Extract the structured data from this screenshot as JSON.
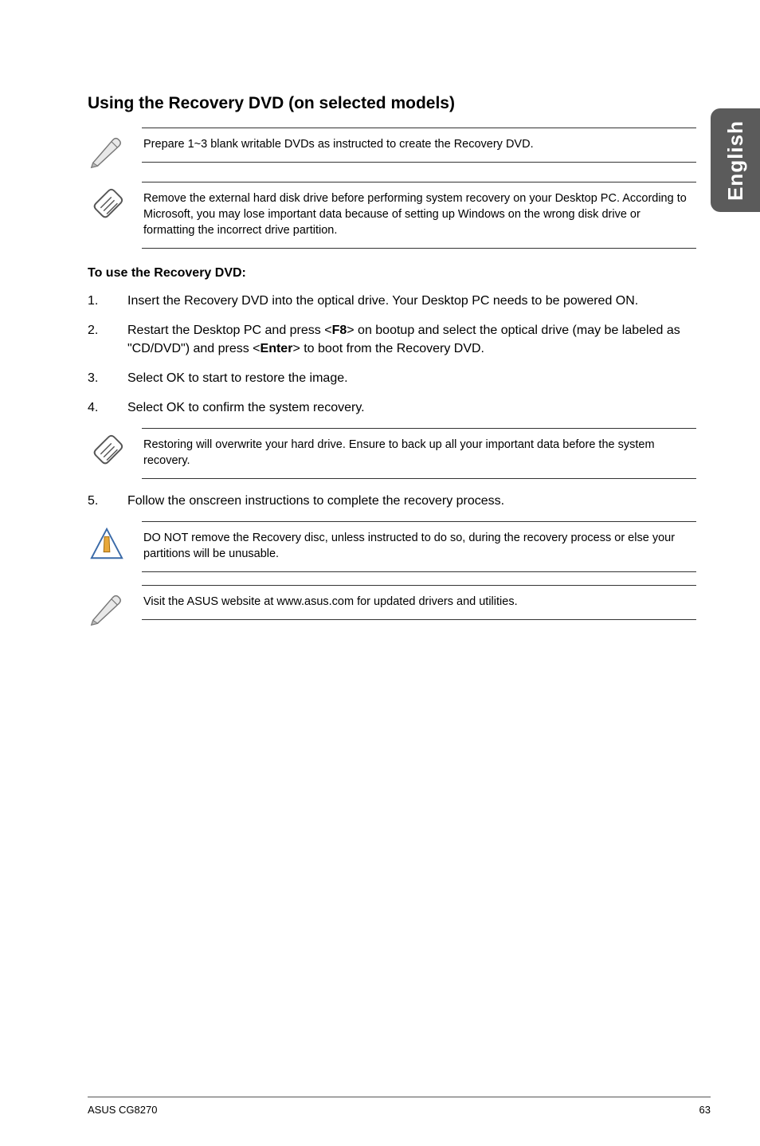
{
  "side_label": "English",
  "heading": "Using the Recovery DVD (on selected models)",
  "note_prepare": "Prepare 1~3 blank writable DVDs as instructed to create the Recovery DVD.",
  "note_remove": "Remove the external hard disk drive before performing system recovery on your Desktop PC. According to Microsoft, you may lose important data because of setting up Windows on the wrong disk drive or formatting the incorrect drive partition.",
  "section_title": "To use the Recovery DVD:",
  "steps": {
    "s1": "Insert the Recovery DVD into the optical drive. Your Desktop PC needs to be powered ON.",
    "s2_pre": "Restart the Desktop PC and press <",
    "s2_key1": "F8",
    "s2_mid": "> on bootup and select the optical drive (may be labeled as \"CD/DVD\") and press <",
    "s2_key2": "Enter",
    "s2_post": "> to boot from the Recovery DVD.",
    "s3": "Select OK to start to restore the image.",
    "s4": "Select OK to confirm the system recovery.",
    "s5": "Follow the onscreen instructions to complete the recovery process."
  },
  "note_restore": "Restoring will overwrite your hard drive. Ensure to back up all your important data before the system recovery.",
  "note_donot": "DO NOT remove the Recovery disc, unless instructed to do so, during the recovery process or else your partitions will be unusable.",
  "note_visit": "Visit the ASUS website at www.asus.com for updated drivers and utilities.",
  "footer_left": "ASUS CG8270",
  "footer_right": "63"
}
